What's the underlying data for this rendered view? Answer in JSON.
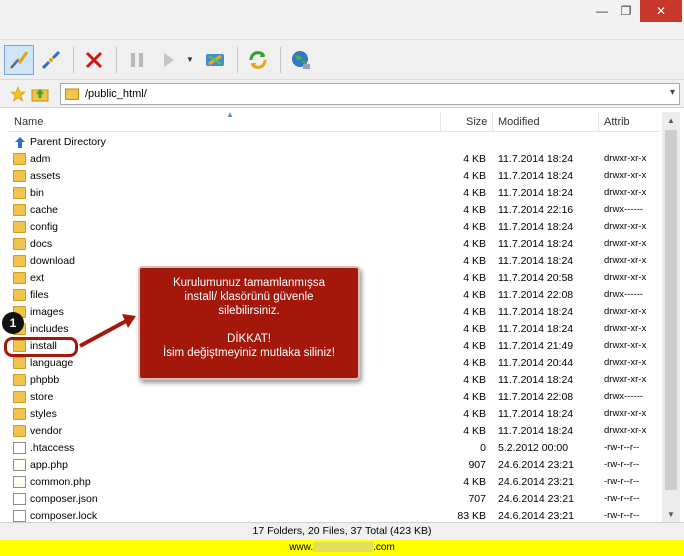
{
  "window": {
    "minimize_label": "—",
    "maximize_label": "❐",
    "close_label": "✕"
  },
  "address": {
    "path": "/public_html/"
  },
  "columns": {
    "name": "Name",
    "size": "Size",
    "modified": "Modified",
    "attrib": "Attrib"
  },
  "rows": [
    {
      "name": "Parent Directory",
      "size": "",
      "modified": "",
      "attrib": "",
      "type": "parent"
    },
    {
      "name": "adm",
      "size": "4 KB",
      "modified": "11.7.2014 18:24",
      "attrib": "drwxr-xr-x",
      "type": "folder"
    },
    {
      "name": "assets",
      "size": "4 KB",
      "modified": "11.7.2014 18:24",
      "attrib": "drwxr-xr-x",
      "type": "folder"
    },
    {
      "name": "bin",
      "size": "4 KB",
      "modified": "11.7.2014 18:24",
      "attrib": "drwxr-xr-x",
      "type": "folder"
    },
    {
      "name": "cache",
      "size": "4 KB",
      "modified": "11.7.2014 22:16",
      "attrib": "drwx------",
      "type": "folder"
    },
    {
      "name": "config",
      "size": "4 KB",
      "modified": "11.7.2014 18:24",
      "attrib": "drwxr-xr-x",
      "type": "folder"
    },
    {
      "name": "docs",
      "size": "4 KB",
      "modified": "11.7.2014 18:24",
      "attrib": "drwxr-xr-x",
      "type": "folder"
    },
    {
      "name": "download",
      "size": "4 KB",
      "modified": "11.7.2014 18:24",
      "attrib": "drwxr-xr-x",
      "type": "folder"
    },
    {
      "name": "ext",
      "size": "4 KB",
      "modified": "11.7.2014 20:58",
      "attrib": "drwxr-xr-x",
      "type": "folder"
    },
    {
      "name": "files",
      "size": "4 KB",
      "modified": "11.7.2014 22:08",
      "attrib": "drwx------",
      "type": "folder"
    },
    {
      "name": "images",
      "size": "4 KB",
      "modified": "11.7.2014 18:24",
      "attrib": "drwxr-xr-x",
      "type": "folder"
    },
    {
      "name": "includes",
      "size": "4 KB",
      "modified": "11.7.2014 18:24",
      "attrib": "drwxr-xr-x",
      "type": "folder"
    },
    {
      "name": "install",
      "size": "4 KB",
      "modified": "11.7.2014 21:49",
      "attrib": "drwxr-xr-x",
      "type": "folder"
    },
    {
      "name": "language",
      "size": "4 KB",
      "modified": "11.7.2014 20:44",
      "attrib": "drwxr-xr-x",
      "type": "folder"
    },
    {
      "name": "phpbb",
      "size": "4 KB",
      "modified": "11.7.2014 18:24",
      "attrib": "drwxr-xr-x",
      "type": "folder"
    },
    {
      "name": "store",
      "size": "4 KB",
      "modified": "11.7.2014 22:08",
      "attrib": "drwx------",
      "type": "folder"
    },
    {
      "name": "styles",
      "size": "4 KB",
      "modified": "11.7.2014 18:24",
      "attrib": "drwxr-xr-x",
      "type": "folder"
    },
    {
      "name": "vendor",
      "size": "4 KB",
      "modified": "11.7.2014 18:24",
      "attrib": "drwxr-xr-x",
      "type": "folder"
    },
    {
      "name": ".htaccess",
      "size": "0",
      "modified": "5.2.2012 00:00",
      "attrib": "-rw-r--r--",
      "type": "file"
    },
    {
      "name": "app.php",
      "size": "907",
      "modified": "24.6.2014 23:21",
      "attrib": "-rw-r--r--",
      "type": "php"
    },
    {
      "name": "common.php",
      "size": "4 KB",
      "modified": "24.6.2014 23:21",
      "attrib": "-rw-r--r--",
      "type": "php"
    },
    {
      "name": "composer.json",
      "size": "707",
      "modified": "24.6.2014 23:21",
      "attrib": "-rw-r--r--",
      "type": "file"
    },
    {
      "name": "composer.lock",
      "size": "83 KB",
      "modified": "24.6.2014 23:21",
      "attrib": "-rw-r--r--",
      "type": "file"
    }
  ],
  "status": {
    "text": "17 Folders, 20 Files, 37 Total (423 KB)"
  },
  "web": {
    "prefix": "www.",
    "suffix": ".com"
  },
  "callout": {
    "line1": "Kurulumunuz tamamlanmışsa",
    "line2": "install/ klasörünü güvenle",
    "line3": "silebilirsiniz.",
    "line4": "DİKKAT!",
    "line5": "İsim değiştmeyiniz mutlaka siliniz!"
  },
  "badge": {
    "number": "1"
  },
  "colors": {
    "accent": "#a3180b",
    "folder": "#f2c44d",
    "status_yellow": "#ffff00"
  },
  "icons": [
    "connect-icon",
    "disconnect-icon",
    "abort-icon",
    "pause-icon",
    "transfer-icon",
    "sync-icon",
    "refresh-icon",
    "globe-icon",
    "bookmark-star-icon",
    "up-folder-icon",
    "folder-icon"
  ]
}
